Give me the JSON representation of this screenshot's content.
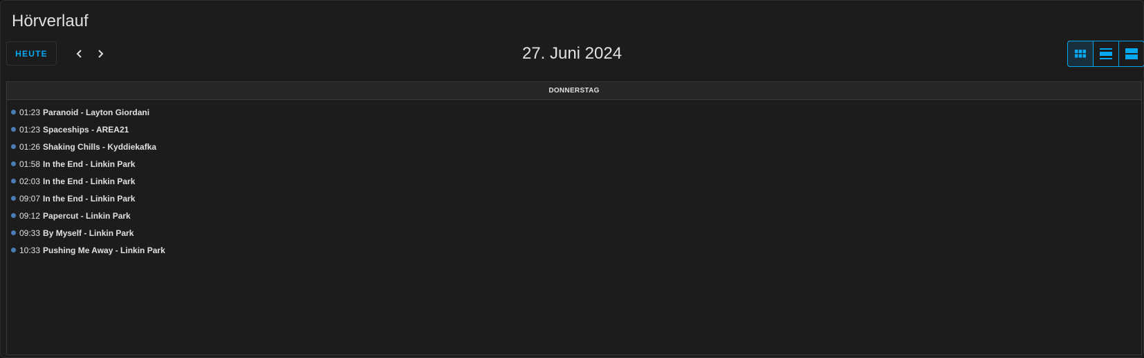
{
  "header": {
    "title": "Hörverlauf"
  },
  "toolbar": {
    "today_label": "HEUTE",
    "prev_icon": "chevron-left-icon",
    "next_icon": "chevron-right-icon",
    "date_title": "27. Juni 2024",
    "views": [
      {
        "name": "month",
        "icon": "grid-icon",
        "active": true
      },
      {
        "name": "week",
        "icon": "list-view-icon",
        "active": false
      },
      {
        "name": "day",
        "icon": "day-view-icon",
        "active": false
      }
    ]
  },
  "calendar": {
    "day_header": "DONNERSTAG",
    "events": [
      {
        "time": "01:23",
        "title": "Paranoid - Layton Giordani"
      },
      {
        "time": "01:23",
        "title": "Spaceships - AREA21"
      },
      {
        "time": "01:26",
        "title": "Shaking Chills - Kyddiekafka"
      },
      {
        "time": "01:58",
        "title": "In the End - Linkin Park"
      },
      {
        "time": "02:03",
        "title": "In the End - Linkin Park"
      },
      {
        "time": "09:07",
        "title": "In the End - Linkin Park"
      },
      {
        "time": "09:12",
        "title": "Papercut - Linkin Park"
      },
      {
        "time": "09:33",
        "title": "By Myself - Linkin Park"
      },
      {
        "time": "10:33",
        "title": "Pushing Me Away - Linkin Park"
      }
    ]
  },
  "colors": {
    "accent": "#03a9f4",
    "event_dot": "#4a7db5",
    "background": "#1c1c1c",
    "text": "#e1e1e1"
  }
}
